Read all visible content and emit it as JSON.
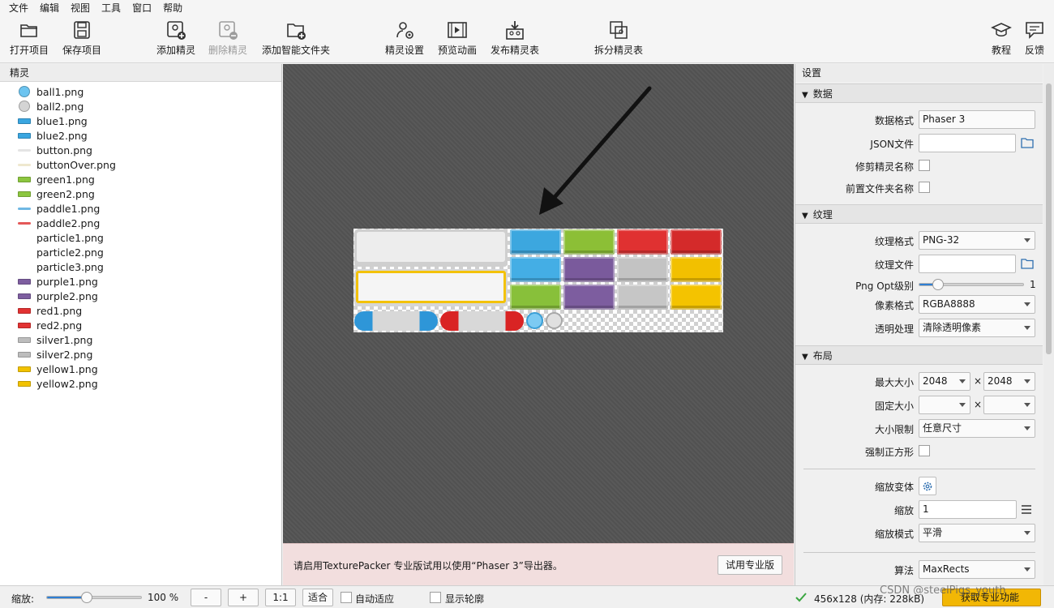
{
  "menu": [
    "文件",
    "编辑",
    "视图",
    "工具",
    "窗口",
    "帮助"
  ],
  "toolbar": {
    "open_project": "打开项目",
    "save_project": "保存项目",
    "add_sprite": "添加精灵",
    "remove_sprite": "删除精灵",
    "add_smart_folder": "添加智能文件夹",
    "sprite_settings": "精灵设置",
    "preview_anim": "预览动画",
    "publish": "发布精灵表",
    "split": "拆分精灵表",
    "tutorial": "教程",
    "feedback": "反馈"
  },
  "left_panel": {
    "title": "精灵",
    "sprites": [
      {
        "name": "ball1.png",
        "kind": "ball",
        "color": "#6cc4f0"
      },
      {
        "name": "ball2.png",
        "kind": "ball",
        "color": "#d4d4d4"
      },
      {
        "name": "blue1.png",
        "kind": "bar",
        "color": "#3aa6e0"
      },
      {
        "name": "blue2.png",
        "kind": "bar",
        "color": "#3aa6e0"
      },
      {
        "name": "button.png",
        "kind": "thin",
        "color": "#e4e4e4"
      },
      {
        "name": "buttonOver.png",
        "kind": "thin",
        "color": "#efe8cf"
      },
      {
        "name": "green1.png",
        "kind": "bar",
        "color": "#8cc63f"
      },
      {
        "name": "green2.png",
        "kind": "bar",
        "color": "#8cc63f"
      },
      {
        "name": "paddle1.png",
        "kind": "thin",
        "color": "#6fb8e4"
      },
      {
        "name": "paddle2.png",
        "kind": "thin",
        "color": "#e45858"
      },
      {
        "name": "particle1.png",
        "kind": "none",
        "color": ""
      },
      {
        "name": "particle2.png",
        "kind": "none",
        "color": ""
      },
      {
        "name": "particle3.png",
        "kind": "none",
        "color": ""
      },
      {
        "name": "purple1.png",
        "kind": "bar",
        "color": "#7e5ea0"
      },
      {
        "name": "purple2.png",
        "kind": "bar",
        "color": "#7e5ea0"
      },
      {
        "name": "red1.png",
        "kind": "bar",
        "color": "#e23232"
      },
      {
        "name": "red2.png",
        "kind": "bar",
        "color": "#e23232"
      },
      {
        "name": "silver1.png",
        "kind": "bar",
        "color": "#bdbdbd"
      },
      {
        "name": "silver2.png",
        "kind": "bar",
        "color": "#bdbdbd"
      },
      {
        "name": "yellow1.png",
        "kind": "bar",
        "color": "#f2c200"
      },
      {
        "name": "yellow2.png",
        "kind": "bar",
        "color": "#f2c200"
      }
    ]
  },
  "banner": {
    "message": "请启用TexturePacker 专业版试用以使用“Phaser 3”导出器。",
    "trial_button": "试用专业版"
  },
  "right_panel": {
    "title": "设置",
    "data": {
      "section": "数据",
      "format_label": "数据格式",
      "format_value": "Phaser 3",
      "json_label": "JSON文件",
      "json_value": "",
      "trim_label": "修剪精灵名称",
      "prepend_label": "前置文件夹名称"
    },
    "texture": {
      "section": "纹理",
      "format_label": "纹理格式",
      "format_value": "PNG-32",
      "file_label": "纹理文件",
      "file_value": "",
      "png_opt_label": "Png Opt级别",
      "png_opt_value": "1",
      "pixel_label": "像素格式",
      "pixel_value": "RGBA8888",
      "alpha_label": "透明处理",
      "alpha_value": "清除透明像素"
    },
    "layout": {
      "section": "布局",
      "max_label": "最大大小",
      "max_w": "2048",
      "max_h": "2048",
      "times": "×",
      "fixed_label": "固定大小",
      "constraint_label": "大小限制",
      "constraint_value": "任意尺寸",
      "square_label": "强制正方形",
      "scale_variant_label": "缩放变体",
      "scale_label": "缩放",
      "scale_value": "1",
      "scale_mode_label": "缩放模式",
      "scale_mode_value": "平滑",
      "algo_label": "算法",
      "algo_value": "MaxRects"
    }
  },
  "status": {
    "zoom_label": "缩放:",
    "zoom_value": "100 %",
    "zoom_level": 0.42,
    "minus": "-",
    "plus": "+",
    "one_to_one": "1:1",
    "fit": "适合",
    "auto_fit": "自动适应",
    "show_outline": "显示轮廓",
    "size_info": "456x128 (内存: 228kB)",
    "pro_button": "获取专业功能",
    "watermark": "CSDN @steelPigs_youth"
  },
  "atlas": {
    "sprite_count": 21
  }
}
